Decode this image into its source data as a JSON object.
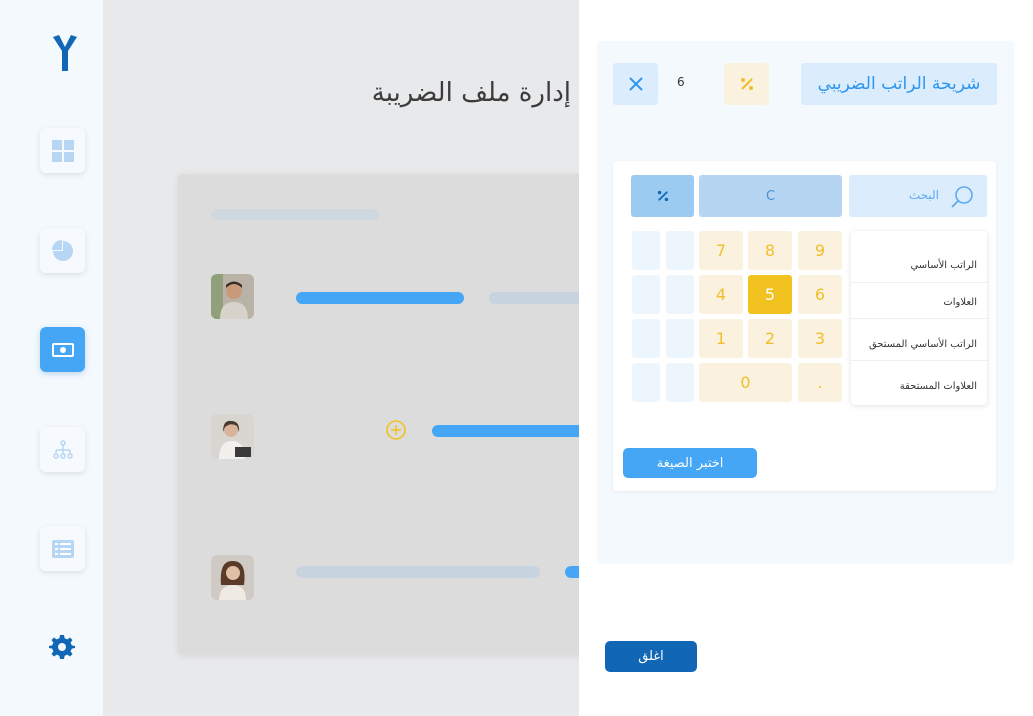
{
  "app": {
    "page_title": "إدارة ملف الضريبة"
  },
  "sidebar": {
    "items": [
      {
        "name": "dashboard",
        "icon": "grid-icon"
      },
      {
        "name": "reports",
        "icon": "pie-chart-icon"
      },
      {
        "name": "payroll",
        "icon": "money-icon",
        "active": true
      },
      {
        "name": "organization",
        "icon": "org-chart-icon"
      },
      {
        "name": "list",
        "icon": "list-icon"
      }
    ],
    "settings_icon": "gear-icon"
  },
  "panel": {
    "title": "شريحة الراتب الضريبي",
    "count": "6",
    "search_placeholder": "البحث",
    "clear_label": "C",
    "keys": [
      "9",
      "8",
      "7",
      "6",
      "5",
      "4",
      "3",
      "2",
      "1",
      ".",
      "0"
    ],
    "active_key": "5",
    "fields": [
      "الراتب الأساسي",
      "العلاوات",
      "الراتب الأساسي المستحق",
      "العلاوات المستحقة"
    ],
    "choose_button": "اختبر الصيغة",
    "close_button": "اغلق"
  },
  "colors": {
    "accent": "#44a6f5",
    "dark_accent": "#1166b6",
    "yellow": "#f2c221"
  }
}
